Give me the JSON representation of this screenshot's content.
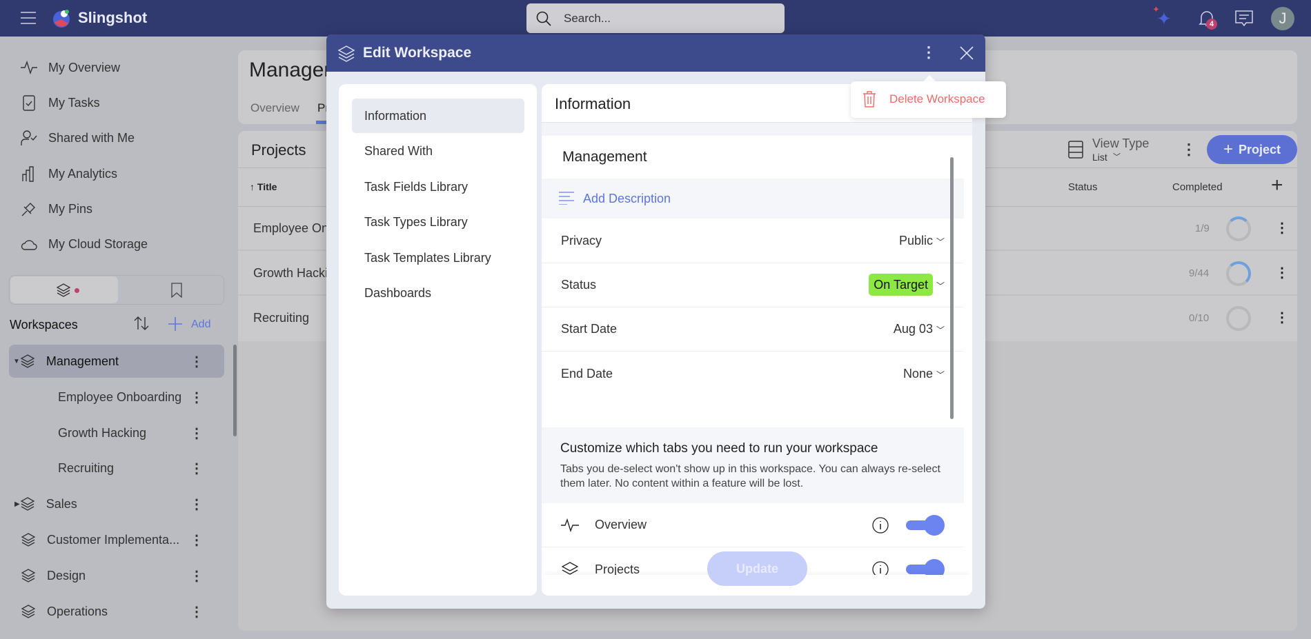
{
  "app": {
    "name": "Slingshot",
    "search_placeholder": "Search...",
    "notification_count": "4",
    "avatar_initial": "J"
  },
  "sidebar": {
    "items": [
      {
        "label": "My Overview",
        "icon": "pulse-icon"
      },
      {
        "label": "My Tasks",
        "icon": "clipboard-check-icon"
      },
      {
        "label": "Shared with Me",
        "icon": "user-check-icon"
      },
      {
        "label": "My Analytics",
        "icon": "bar-chart-icon"
      },
      {
        "label": "My Pins",
        "icon": "pin-icon"
      },
      {
        "label": "My Cloud Storage",
        "icon": "cloud-icon"
      }
    ],
    "workspaces_label": "Workspaces",
    "add_label": "Add",
    "tree": [
      {
        "label": "Management",
        "level": 0,
        "expanded": true,
        "selected": true
      },
      {
        "label": "Employee Onboarding",
        "level": 1
      },
      {
        "label": "Growth Hacking",
        "level": 1
      },
      {
        "label": "Recruiting",
        "level": 1
      },
      {
        "label": "Sales",
        "level": 0,
        "expanded": false
      },
      {
        "label": "Customer Implementa...",
        "level": 0
      },
      {
        "label": "Design",
        "level": 0
      },
      {
        "label": "Operations",
        "level": 0
      }
    ]
  },
  "main": {
    "title": "Managem",
    "tabs": [
      "Overview",
      "Pr"
    ],
    "projects_title": "Projects",
    "view_type_label": "View Type",
    "view_type_value": "List",
    "add_project_label": "Project",
    "columns": [
      "Title",
      "Status",
      "Completed"
    ],
    "rows": [
      {
        "title": "Employee Onb",
        "completed": "1/9",
        "progress": 0.11
      },
      {
        "title": "Growth Hackin",
        "completed": "9/44",
        "progress": 0.2
      },
      {
        "title": "Recruiting",
        "completed": "0/10",
        "progress": 0
      }
    ]
  },
  "modal": {
    "title": "Edit Workspace",
    "nav": [
      "Information",
      "Shared With",
      "Task Fields Library",
      "Task Types Library",
      "Task Templates Library",
      "Dashboards"
    ],
    "section_title": "Information",
    "workspace_name": "Management",
    "add_description": "Add Description",
    "fields": [
      {
        "label": "Privacy",
        "value": "Public"
      },
      {
        "label": "Status",
        "value": "On Target"
      },
      {
        "label": "Start Date",
        "value": "Aug 03"
      },
      {
        "label": "End Date",
        "value": "None"
      }
    ],
    "customize_title": "Customize which tabs you need to run your workspace",
    "customize_desc": "Tabs you de-select won't show up in this workspace. You can always re-select them later. No content within a feature will be lost.",
    "tabs": [
      {
        "label": "Overview",
        "enabled": true,
        "icon": "pulse-icon"
      },
      {
        "label": "Projects",
        "enabled": true,
        "icon": "layers-icon"
      }
    ],
    "update_label": "Update",
    "menu": {
      "delete_label": "Delete Workspace"
    }
  },
  "colors": {
    "topbar": "#303a6e",
    "modal_header": "#3d4a8c",
    "accent": "#6b84f0",
    "status_on_target": "#8ee844",
    "danger": "#f06a6a"
  }
}
